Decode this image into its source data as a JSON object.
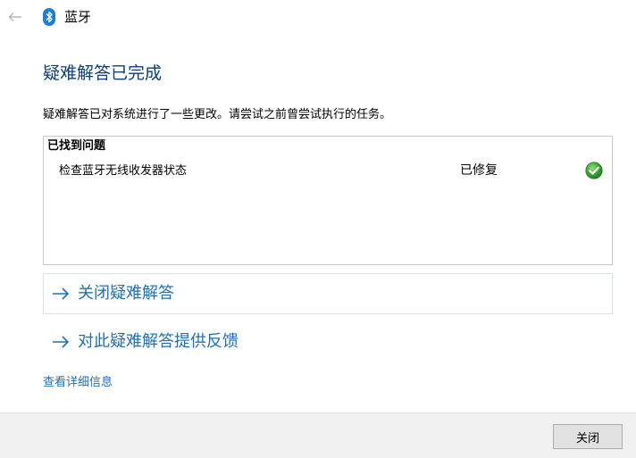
{
  "header": {
    "back_icon": "back-arrow-icon",
    "app_icon": "bluetooth-icon",
    "title": "蓝牙",
    "bluetooth_color": "#1b7fd8"
  },
  "main": {
    "title": "疑难解答已完成",
    "description": "疑难解答已对系统进行了一些更改。请尝试之前曾尝试执行的任务。",
    "problems": {
      "header": "已找到问题",
      "items": [
        {
          "name": "检查蓝牙无线收发器状态",
          "status": "已修复",
          "status_icon": "check-circle-icon"
        }
      ]
    },
    "actions": [
      {
        "label": "关闭疑难解答",
        "icon": "arrow-right-icon"
      },
      {
        "label": "对此疑难解答提供反馈",
        "icon": "arrow-right-icon"
      }
    ],
    "details_link": "查看详细信息"
  },
  "footer": {
    "close_label": "关闭"
  },
  "colors": {
    "title": "#0a3d7a",
    "link": "#1a6fbf",
    "success": "#3aa832"
  }
}
